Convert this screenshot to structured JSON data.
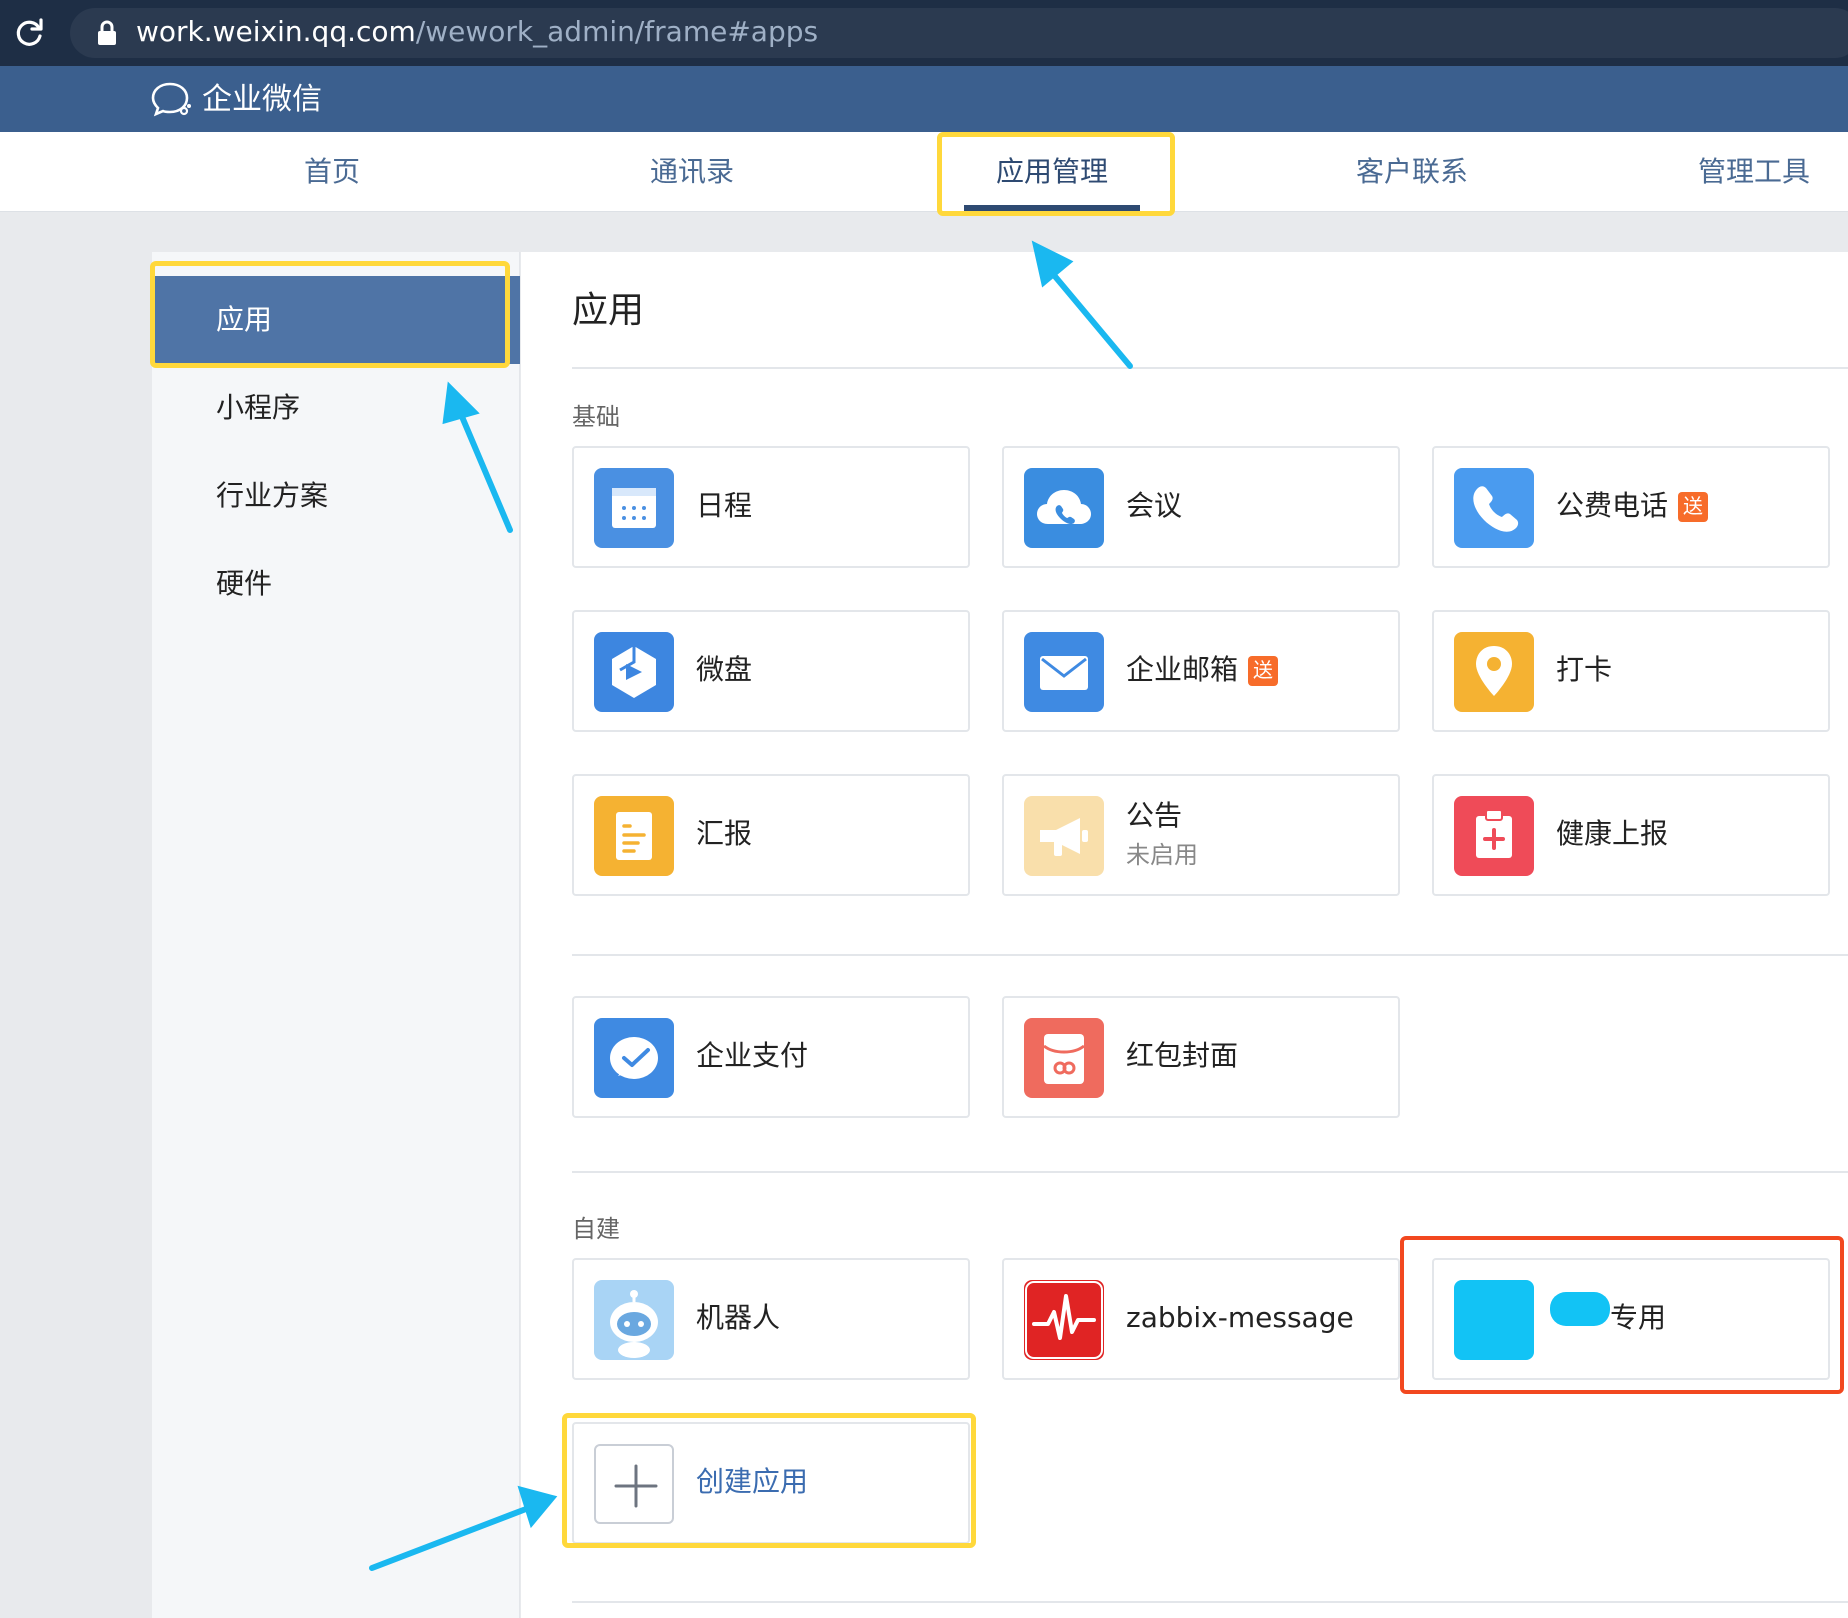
{
  "browser": {
    "url_host": "work.weixin.qq.com",
    "url_path": "/wework_admin/frame#apps"
  },
  "header": {
    "logo_text": "企业微信"
  },
  "nav": {
    "items": [
      {
        "label": "首页"
      },
      {
        "label": "通讯录"
      },
      {
        "label": "应用管理",
        "active": true
      },
      {
        "label": "客户联系"
      },
      {
        "label": "管理工具"
      }
    ]
  },
  "sidebar": {
    "items": [
      {
        "label": "应用",
        "active": true
      },
      {
        "label": "小程序"
      },
      {
        "label": "行业方案"
      },
      {
        "label": "硬件"
      }
    ]
  },
  "main": {
    "title": "应用",
    "sections": {
      "basic_label": "基础",
      "custom_label": "自建"
    },
    "basic_apps": [
      {
        "label": "日程",
        "icon": "calendar-icon",
        "color": "#4a90e2"
      },
      {
        "label": "会议",
        "icon": "meeting-cloud-icon",
        "color": "#3a8de0"
      },
      {
        "label": "公费电话",
        "icon": "phone-icon",
        "color": "#4a9bef",
        "badge": "送"
      },
      {
        "label": "微盘",
        "icon": "drive-icon",
        "color": "#3d86e0"
      },
      {
        "label": "企业邮箱",
        "icon": "mail-icon",
        "color": "#3f8ae2",
        "badge": "送"
      },
      {
        "label": "打卡",
        "icon": "location-pin-icon",
        "color": "#f5b232"
      },
      {
        "label": "汇报",
        "icon": "report-icon",
        "color": "#f5b232"
      },
      {
        "label": "公告",
        "sub": "未启用",
        "icon": "megaphone-icon",
        "color": "#f9dfab"
      },
      {
        "label": "健康上报",
        "icon": "health-icon",
        "color": "#ef4b58"
      }
    ],
    "pay_apps": [
      {
        "label": "企业支付",
        "icon": "payment-icon",
        "color": "#3f8ae2"
      },
      {
        "label": "红包封面",
        "icon": "red-packet-icon",
        "color": "#ef6b5e"
      }
    ],
    "custom_apps": [
      {
        "label": "机器人",
        "icon": "robot-icon",
        "color": "#a9d4f5"
      },
      {
        "label": "zabbix-message",
        "icon": "zabbix-pulse-icon",
        "color": "#e02424"
      },
      {
        "label": "专用",
        "icon": "redacted-icon",
        "color": "#12c3f5"
      }
    ],
    "create_app_label": "创建应用"
  }
}
